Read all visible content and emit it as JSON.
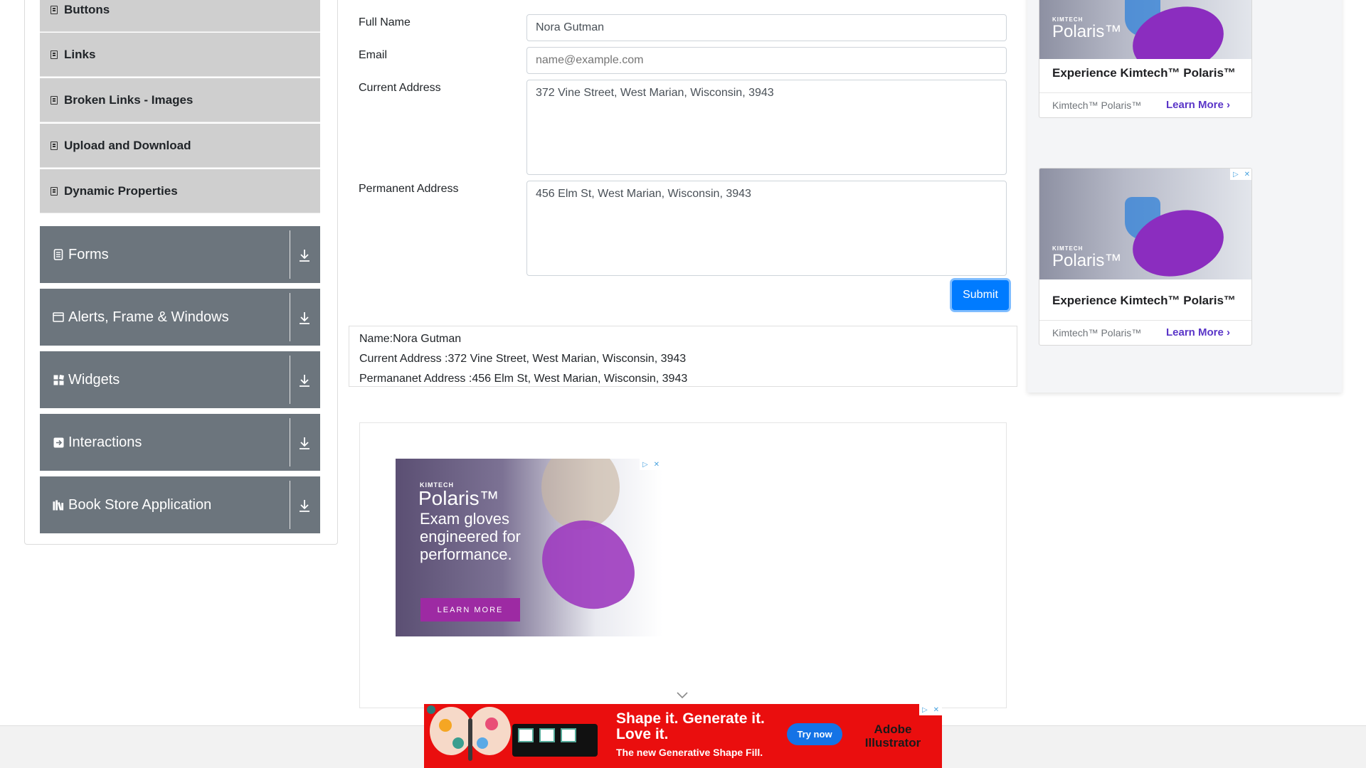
{
  "sidebar": {
    "sub_items": [
      {
        "label": "Buttons"
      },
      {
        "label": "Links"
      },
      {
        "label": "Broken Links - Images"
      },
      {
        "label": "Upload and Download"
      },
      {
        "label": "Dynamic Properties"
      }
    ],
    "groups": [
      {
        "label": "Forms",
        "icon": "document-icon"
      },
      {
        "label": "Alerts, Frame & Windows",
        "icon": "window-icon"
      },
      {
        "label": "Widgets",
        "icon": "widgets-grid-icon"
      },
      {
        "label": "Interactions",
        "icon": "interactions-icon"
      },
      {
        "label": "Book Store Application",
        "icon": "books-icon"
      }
    ]
  },
  "form": {
    "full_name_label": "Full Name",
    "full_name_value": "Nora Gutman",
    "email_label": "Email",
    "email_placeholder": "name@example.com",
    "current_address_label": "Current Address",
    "current_address_value": "372 Vine Street, West Marian, Wisconsin, 3943",
    "permanent_address_label": "Permanent Address",
    "permanent_address_value": "456 Elm St, West Marian, Wisconsin, 3943",
    "submit_label": "Submit"
  },
  "output": {
    "name": "Name:Nora Gutman",
    "current_address": "Current Address :372 Vine Street, West Marian, Wisconsin, 3943",
    "permanent_address": "Permananet Address :456 Elm St, West Marian, Wisconsin, 3943"
  },
  "center_ad": {
    "brand_small": "KIMTECH",
    "brand": "Polaris™",
    "slogan": "Exam gloves engineered for performance.",
    "cta": "LEARN MORE"
  },
  "side_ads": [
    {
      "brand_small": "KIMTECH",
      "brand": "Polaris™",
      "title": "Experience Kimtech™ Polaris™",
      "source": "Kimtech™ Polaris™",
      "cta": "Learn More"
    },
    {
      "brand_small": "KIMTECH",
      "brand": "Polaris™",
      "title": "Experience Kimtech™ Polaris™",
      "source": "Kimtech™ Polaris™",
      "cta": "Learn More"
    }
  ],
  "bottom_ad": {
    "headline": "Shape it. Generate it. Love it.",
    "subline": "The new Generative Shape Fill.",
    "cta": "Try now",
    "product": "Adobe Illustrator"
  },
  "colors": {
    "sidebar_group_bg": "#6c757d",
    "sidebar_item_bg": "#cfcfcf",
    "submit_bg": "#007bff",
    "bottom_ad_bg": "#ea0e0e"
  }
}
